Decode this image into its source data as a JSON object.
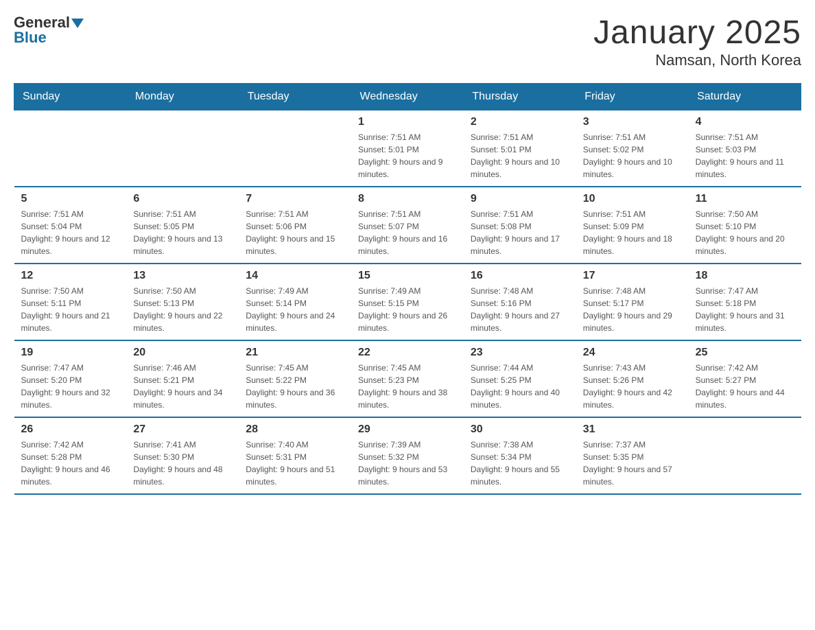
{
  "logo": {
    "general": "General",
    "blue": "Blue"
  },
  "title": "January 2025",
  "subtitle": "Namsan, North Korea",
  "days_of_week": [
    "Sunday",
    "Monday",
    "Tuesday",
    "Wednesday",
    "Thursday",
    "Friday",
    "Saturday"
  ],
  "weeks": [
    [
      {
        "day": "",
        "info": ""
      },
      {
        "day": "",
        "info": ""
      },
      {
        "day": "",
        "info": ""
      },
      {
        "day": "1",
        "info": "Sunrise: 7:51 AM\nSunset: 5:01 PM\nDaylight: 9 hours and 9 minutes."
      },
      {
        "day": "2",
        "info": "Sunrise: 7:51 AM\nSunset: 5:01 PM\nDaylight: 9 hours and 10 minutes."
      },
      {
        "day": "3",
        "info": "Sunrise: 7:51 AM\nSunset: 5:02 PM\nDaylight: 9 hours and 10 minutes."
      },
      {
        "day": "4",
        "info": "Sunrise: 7:51 AM\nSunset: 5:03 PM\nDaylight: 9 hours and 11 minutes."
      }
    ],
    [
      {
        "day": "5",
        "info": "Sunrise: 7:51 AM\nSunset: 5:04 PM\nDaylight: 9 hours and 12 minutes."
      },
      {
        "day": "6",
        "info": "Sunrise: 7:51 AM\nSunset: 5:05 PM\nDaylight: 9 hours and 13 minutes."
      },
      {
        "day": "7",
        "info": "Sunrise: 7:51 AM\nSunset: 5:06 PM\nDaylight: 9 hours and 15 minutes."
      },
      {
        "day": "8",
        "info": "Sunrise: 7:51 AM\nSunset: 5:07 PM\nDaylight: 9 hours and 16 minutes."
      },
      {
        "day": "9",
        "info": "Sunrise: 7:51 AM\nSunset: 5:08 PM\nDaylight: 9 hours and 17 minutes."
      },
      {
        "day": "10",
        "info": "Sunrise: 7:51 AM\nSunset: 5:09 PM\nDaylight: 9 hours and 18 minutes."
      },
      {
        "day": "11",
        "info": "Sunrise: 7:50 AM\nSunset: 5:10 PM\nDaylight: 9 hours and 20 minutes."
      }
    ],
    [
      {
        "day": "12",
        "info": "Sunrise: 7:50 AM\nSunset: 5:11 PM\nDaylight: 9 hours and 21 minutes."
      },
      {
        "day": "13",
        "info": "Sunrise: 7:50 AM\nSunset: 5:13 PM\nDaylight: 9 hours and 22 minutes."
      },
      {
        "day": "14",
        "info": "Sunrise: 7:49 AM\nSunset: 5:14 PM\nDaylight: 9 hours and 24 minutes."
      },
      {
        "day": "15",
        "info": "Sunrise: 7:49 AM\nSunset: 5:15 PM\nDaylight: 9 hours and 26 minutes."
      },
      {
        "day": "16",
        "info": "Sunrise: 7:48 AM\nSunset: 5:16 PM\nDaylight: 9 hours and 27 minutes."
      },
      {
        "day": "17",
        "info": "Sunrise: 7:48 AM\nSunset: 5:17 PM\nDaylight: 9 hours and 29 minutes."
      },
      {
        "day": "18",
        "info": "Sunrise: 7:47 AM\nSunset: 5:18 PM\nDaylight: 9 hours and 31 minutes."
      }
    ],
    [
      {
        "day": "19",
        "info": "Sunrise: 7:47 AM\nSunset: 5:20 PM\nDaylight: 9 hours and 32 minutes."
      },
      {
        "day": "20",
        "info": "Sunrise: 7:46 AM\nSunset: 5:21 PM\nDaylight: 9 hours and 34 minutes."
      },
      {
        "day": "21",
        "info": "Sunrise: 7:45 AM\nSunset: 5:22 PM\nDaylight: 9 hours and 36 minutes."
      },
      {
        "day": "22",
        "info": "Sunrise: 7:45 AM\nSunset: 5:23 PM\nDaylight: 9 hours and 38 minutes."
      },
      {
        "day": "23",
        "info": "Sunrise: 7:44 AM\nSunset: 5:25 PM\nDaylight: 9 hours and 40 minutes."
      },
      {
        "day": "24",
        "info": "Sunrise: 7:43 AM\nSunset: 5:26 PM\nDaylight: 9 hours and 42 minutes."
      },
      {
        "day": "25",
        "info": "Sunrise: 7:42 AM\nSunset: 5:27 PM\nDaylight: 9 hours and 44 minutes."
      }
    ],
    [
      {
        "day": "26",
        "info": "Sunrise: 7:42 AM\nSunset: 5:28 PM\nDaylight: 9 hours and 46 minutes."
      },
      {
        "day": "27",
        "info": "Sunrise: 7:41 AM\nSunset: 5:30 PM\nDaylight: 9 hours and 48 minutes."
      },
      {
        "day": "28",
        "info": "Sunrise: 7:40 AM\nSunset: 5:31 PM\nDaylight: 9 hours and 51 minutes."
      },
      {
        "day": "29",
        "info": "Sunrise: 7:39 AM\nSunset: 5:32 PM\nDaylight: 9 hours and 53 minutes."
      },
      {
        "day": "30",
        "info": "Sunrise: 7:38 AM\nSunset: 5:34 PM\nDaylight: 9 hours and 55 minutes."
      },
      {
        "day": "31",
        "info": "Sunrise: 7:37 AM\nSunset: 5:35 PM\nDaylight: 9 hours and 57 minutes."
      },
      {
        "day": "",
        "info": ""
      }
    ]
  ]
}
